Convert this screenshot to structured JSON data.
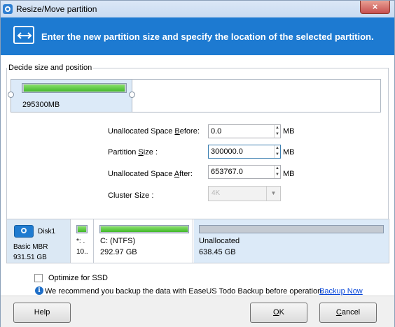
{
  "window": {
    "title": "Resize/Move partition",
    "close_glyph": "×",
    "app_icon": "easeus-app-icon"
  },
  "banner": {
    "icon": "resize-arrows-icon",
    "text": "Enter the new partition size and specify the location of the selected partition."
  },
  "group": {
    "label": "Decide size and position",
    "partition_size_text": "295300MB",
    "used_fraction": 0.97
  },
  "fields": {
    "before": {
      "label_pre": "Unallocated Space ",
      "label_key": "B",
      "label_post": "efore:",
      "value": "0.0",
      "unit": "MB"
    },
    "size": {
      "label_pre": "Partition ",
      "label_key": "S",
      "label_post": "ize :",
      "value": "300000.0",
      "unit": "MB"
    },
    "after": {
      "label_pre": "Unallocated Space ",
      "label_key": "A",
      "label_post": "fter:",
      "value": "653767.0",
      "unit": "MB"
    },
    "cluster": {
      "label": "Cluster Size :",
      "value": "4K"
    }
  },
  "disk": {
    "name": "Disk1",
    "type": "Basic MBR",
    "size": "931.51 GB",
    "partitions": [
      {
        "line1": "*: .",
        "line2": "10..",
        "used_fraction": 0.95
      },
      {
        "line1": "C: (NTFS)",
        "line2": "292.97 GB",
        "used_fraction": 0.98
      },
      {
        "line1": "Unallocated",
        "line2": "638.45 GB",
        "used_fraction": 0
      }
    ]
  },
  "options": {
    "ssd_label": "Optimize for SSD",
    "ssd_checked": false
  },
  "info": {
    "text": "We recommend you backup the data with EaseUS Todo Backup before operation.",
    "link": "Backup Now"
  },
  "buttons": {
    "help": "Help",
    "ok": "OK",
    "ok_key": "O",
    "ok_rest": "K",
    "cancel": "Cancel",
    "cancel_key": "C",
    "cancel_rest": "ancel"
  },
  "colors": {
    "banner": "#1d7ad1",
    "bar_fill": "#43b92b",
    "selected_partition_bg": "#dceaf8",
    "link": "#0645d8"
  }
}
